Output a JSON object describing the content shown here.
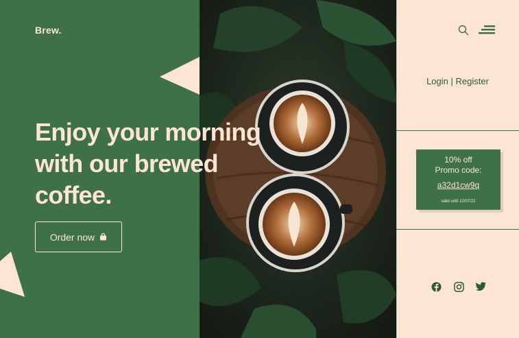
{
  "brand": {
    "logo": "Brew."
  },
  "hero": {
    "line1": "Enjoy your morning",
    "line2": "with our brewed",
    "line3": "coffee."
  },
  "cta": {
    "label": "Order now"
  },
  "header": {
    "search_icon": "search-icon",
    "menu_icon": "menu-icon"
  },
  "auth": {
    "login": "Login",
    "separator": "|",
    "register": "Register"
  },
  "promo": {
    "line1": "10% off",
    "line2": "Promo code:",
    "code": "a32d1cw9q",
    "valid": "valid until 12/07/22"
  },
  "social": [
    "facebook-icon",
    "instagram-icon",
    "twitter-icon"
  ],
  "colors": {
    "green": "#3f7149",
    "cream": "#fde5d3",
    "dark_green": "#2e5a37"
  }
}
